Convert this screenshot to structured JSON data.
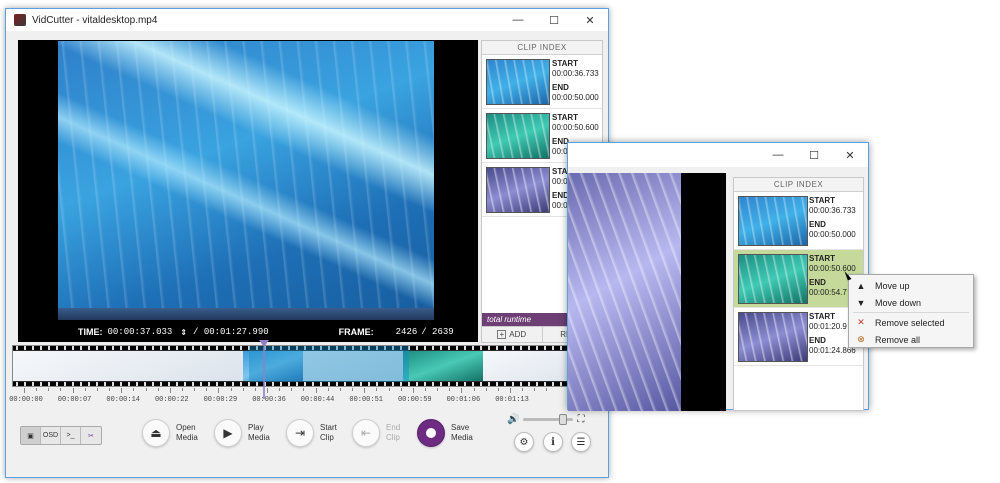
{
  "main_window": {
    "title": "VidCutter - vitaldesktop.mp4",
    "controls": {
      "minimize": "—",
      "maximize": "☐",
      "close": "✕"
    },
    "video": {
      "time_label": "TIME:",
      "time_value": "00:00:37.033",
      "duration": "/ 00:01:27.990",
      "frame_label": "FRAME:",
      "frame_value": "2426",
      "frame_total": "/ 2639"
    },
    "clip_index": {
      "heading": "CLIP INDEX",
      "clips": [
        {
          "start_label": "START",
          "start": "00:00:36.733",
          "end_label": "END",
          "end": "00:00:50.000"
        },
        {
          "start_label": "START",
          "start": "00:00:50.600",
          "end_label": "END",
          "end": "00:0"
        },
        {
          "start_label": "STA",
          "start": "00:01",
          "end_label": "END",
          "end": "00:01"
        }
      ],
      "runtime_label": "total runtime",
      "runtime_value": "0",
      "add_label": "ADD",
      "remove_label": "REMO"
    },
    "timeline": {
      "labels": [
        "00:00:00",
        "00:00:07",
        "00:00:14",
        "00:00:22",
        "00:00:29",
        "00:00:36",
        "00:00:44",
        "00:00:51",
        "00:00:59",
        "00:01:06",
        "00:01:13"
      ]
    },
    "toolbar": {
      "mode_buttons": [
        "▣",
        "OSD",
        ">_",
        "✂"
      ],
      "open_media": [
        "Open",
        "Media"
      ],
      "play_media": [
        "Play",
        "Media"
      ],
      "start_clip": [
        "Start",
        "Clip"
      ],
      "end_clip": [
        "End",
        "Clip"
      ],
      "save_media": [
        "Save",
        "Media"
      ]
    }
  },
  "secondary_window": {
    "controls": {
      "minimize": "—",
      "maximize": "☐",
      "close": "✕"
    },
    "clip_index": {
      "heading": "CLIP INDEX",
      "clips": [
        {
          "start_label": "START",
          "start": "00:00:36.733",
          "end_label": "END",
          "end": "00:00:50.000"
        },
        {
          "start_label": "START",
          "start": "00:00:50.600",
          "end_label": "END",
          "end": "00:00:54.7"
        },
        {
          "start_label": "START",
          "start": "00:01:20.9",
          "end_label": "END",
          "end": "00:01:24.866"
        }
      ]
    }
  },
  "context_menu": {
    "move_up": "Move up",
    "move_down": "Move down",
    "remove_selected": "Remove selected",
    "remove_all": "Remove all"
  },
  "colors": {
    "accent_purple": "#6d2c82",
    "selection_green": "#c4d99a",
    "window_border": "#5aa1e3"
  }
}
